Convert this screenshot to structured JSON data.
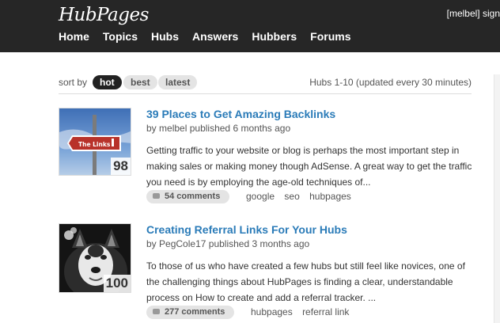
{
  "header": {
    "logo": "HubPages",
    "account": "[melbel] sign",
    "nav": [
      "Home",
      "Topics",
      "Hubs",
      "Answers",
      "Hubbers",
      "Forums"
    ]
  },
  "sortbar": {
    "label": "sort by",
    "options": [
      "hot",
      "best",
      "latest"
    ],
    "active": "hot",
    "count": "Hubs 1-10 (updated every 30 minutes)"
  },
  "hubs": [
    {
      "title": "39 Places to Get Amazing Backlinks",
      "by": "by",
      "author": "melbel",
      "published": "published 6 months ago",
      "summary": "Getting traffic to your website or blog is perhaps the most important step in making sales or making money though AdSense. A great way to get the traffic you need is by employing the age-old techniques of...",
      "score": "98",
      "comments": "54 comments",
      "tags": [
        "google",
        "seo",
        "hubpages"
      ],
      "sign_text": "The Links"
    },
    {
      "title": "Creating Referral Links For Your Hubs",
      "by": "by",
      "author": "PegCole17",
      "published": "published 3 months ago",
      "summary": "To those of us who have created a few hubs but still feel like novices, one of the challenging things about HubPages is finding a clear, understandable process on How to create and add a referral tracker. ...",
      "score": "100",
      "comments": "277 comments",
      "tags": [
        "hubpages",
        "referral link"
      ]
    }
  ]
}
